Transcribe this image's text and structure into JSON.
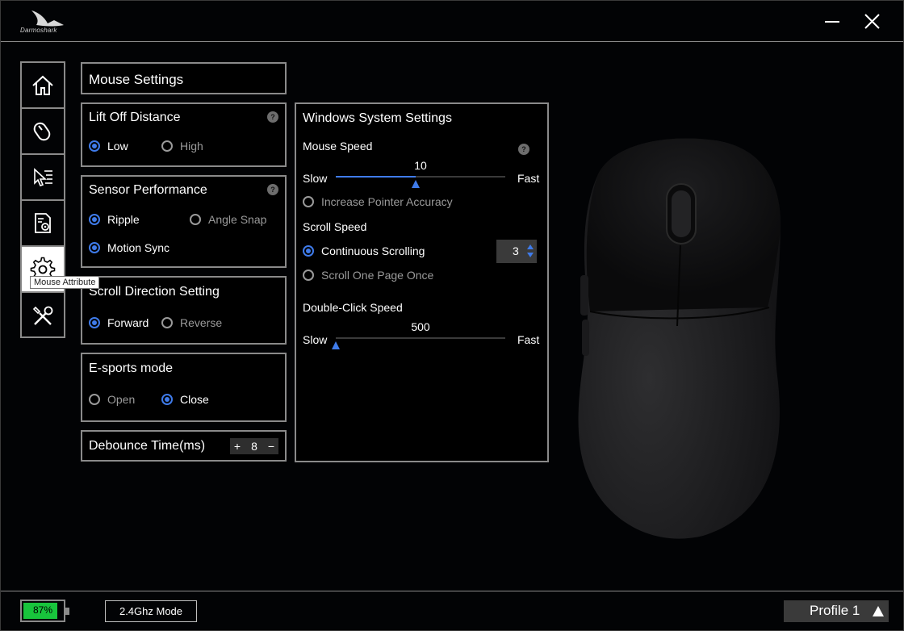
{
  "app": {
    "logo_text": "Darmoshark"
  },
  "sidebar": {
    "items": [
      {
        "name": "home",
        "icon": "home-icon"
      },
      {
        "name": "mouse",
        "icon": "mouse-icon"
      },
      {
        "name": "macro",
        "icon": "cursor-list-icon"
      },
      {
        "name": "config",
        "icon": "document-gear-icon"
      },
      {
        "name": "mouse-attribute",
        "icon": "gear-icon",
        "active": true
      },
      {
        "name": "tools",
        "icon": "tools-icon"
      }
    ],
    "tooltip": "Mouse Attribute"
  },
  "mouse_settings": {
    "header": "Mouse Settings",
    "lift_off": {
      "title": "Lift Off Distance",
      "help": "?",
      "options": [
        {
          "label": "Low",
          "selected": true
        },
        {
          "label": "High",
          "selected": false
        }
      ]
    },
    "sensor": {
      "title": "Sensor Performance",
      "help": "?",
      "options": [
        {
          "label": "Ripple",
          "selected": true
        },
        {
          "label": "Angle Snap",
          "selected": false
        },
        {
          "label": "Motion Sync",
          "selected": true
        }
      ]
    },
    "scroll_direction": {
      "title": "Scroll Direction Setting",
      "options": [
        {
          "label": "Forward",
          "selected": true
        },
        {
          "label": "Reverse",
          "selected": false
        }
      ]
    },
    "esports": {
      "title": "E-sports mode",
      "options": [
        {
          "label": "Open",
          "selected": false
        },
        {
          "label": "Close",
          "selected": true
        }
      ]
    },
    "debounce": {
      "title": "Debounce Time(ms)",
      "plus": "+",
      "value": "8",
      "minus": "−"
    }
  },
  "windows_settings": {
    "title": "Windows System Settings",
    "mouse_speed": {
      "label": "Mouse Speed",
      "help": "?",
      "value": "10",
      "fraction": 0.47,
      "slow": "Slow",
      "fast": "Fast"
    },
    "pointer_accuracy": {
      "label": "Increase Pointer Accuracy",
      "selected": false
    },
    "scroll_speed": {
      "label": "Scroll Speed",
      "continuous": {
        "label": "Continuous Scrolling",
        "selected": true
      },
      "one_page": {
        "label": "Scroll One Page Once",
        "selected": false
      },
      "lines": "3"
    },
    "double_click": {
      "label": "Double-Click Speed",
      "value": "500",
      "fraction": 0.0,
      "slow": "Slow",
      "fast": "Fast"
    }
  },
  "status": {
    "battery": "87%",
    "battery_level": 0.87,
    "connection_mode": "2.4Ghz Mode",
    "profile": "Profile 1"
  },
  "colors": {
    "accent": "#3f7bea",
    "battery": "#18c43c",
    "border": "#8a8a8a"
  }
}
